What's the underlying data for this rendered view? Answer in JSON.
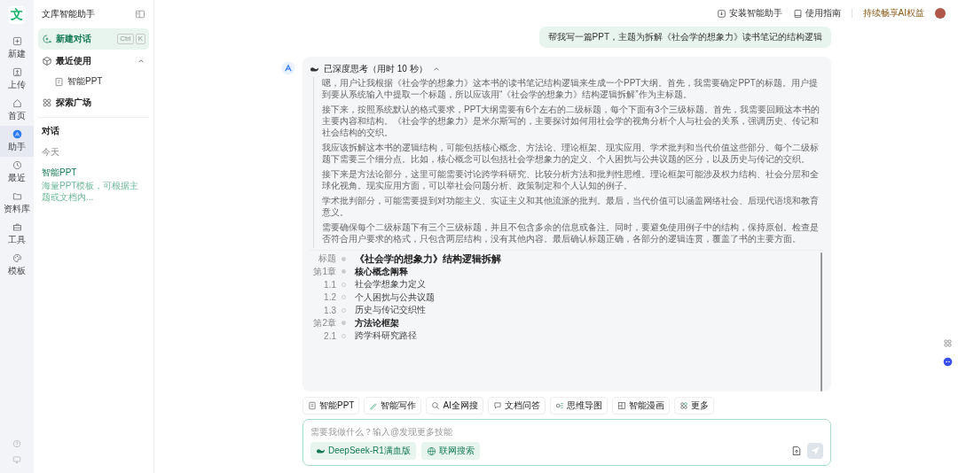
{
  "rail": {
    "logo": "文",
    "items": [
      {
        "label": "新建",
        "selected": false
      },
      {
        "label": "上传",
        "selected": false
      },
      {
        "label": "首页",
        "selected": false
      },
      {
        "label": "助手",
        "selected": true
      },
      {
        "label": "最近",
        "selected": false
      },
      {
        "label": "资料库",
        "selected": false
      },
      {
        "label": "工具",
        "selected": false
      },
      {
        "label": "模板",
        "selected": false
      }
    ]
  },
  "sidebar": {
    "title": "文库智能助手",
    "new_chat": {
      "label": "新建对话",
      "shortcut": [
        "Ctrl",
        "K"
      ]
    },
    "recent": {
      "label": "最近使用",
      "expanded": true,
      "children": [
        {
          "label": "智能PPT"
        }
      ]
    },
    "explore": {
      "label": "探索广场"
    },
    "chats_heading": "对话",
    "groups": [
      {
        "label": "今天",
        "items": [
          {
            "title": "智能PPT",
            "subtitle": "海量PPT模板，可根据主题或文档内...",
            "selected": true
          }
        ]
      }
    ]
  },
  "top_bar": {
    "links": [
      {
        "label": "安装智能助手"
      },
      {
        "label": "使用指南"
      }
    ],
    "promo": "持续畅享AI权益"
  },
  "user_message": "帮我写一篇PPT，主题为拆解《社会学的想象力》读书笔记的结构逻辑",
  "assistant": {
    "thinking": {
      "label": "已深度思考（用时 10 秒）",
      "expanded": true,
      "paragraphs": [
        "嗯，用户让我根据《社会学的想象力》这本书的读书笔记结构逻辑来生成一个PPT大纲。首先，我需要确定PPT的标题。用户提到要从系统输入中提取一个标题，所以应该用“《社会学的想象力》结构逻辑拆解”作为主标题。",
        "接下来，按照系统默认的格式要求，PPT大纲需要有6个左右的二级标题，每个下面有3个三级标题。首先，我需要回顾这本书的主要内容和结构。《社会学的想象力》是米尔斯写的，主要探讨如何用社会学的视角分析个人与社会的关系，强调历史、传记和社会结构的交织。",
        "我应该拆解这本书的逻辑结构，可能包括核心概念、方法论、理论框架、现实应用、学术批判和当代价值这些部分。每个二级标题下需要三个细分点。比如，核心概念可以包括社会学想象力的定义、个人困扰与公共议题的区分，以及历史与传记的交织。",
        "接下来是方法论部分，这里可能需要讨论跨学科研究、比较分析方法和批判性思维。理论框架可能涉及权力结构、社会分层和全球化视角。现实应用方面，可以举社会问题分析、政策制定和个人认知的例子。",
        "学术批判部分，可能需要提到对功能主义、实证主义和其他流派的批判。最后，当代价值可以涵盖网络社会、后现代语境和教育意义。",
        "需要确保每个二级标题下有三个三级标题，并且不包含多余的信息或备注。同时，要避免使用例子中的结构，保持原创。检查是否符合用户要求的格式，只包含两层结构，没有其他内容。最后确认标题正确，各部分的逻辑连贯，覆盖了书的主要方面。"
      ]
    },
    "outline": [
      {
        "kind": "title",
        "label": "标题",
        "text": "《社会学的想象力》结构逻辑拆解"
      },
      {
        "kind": "chapter",
        "label": "第1章",
        "text": "核心概念阐释"
      },
      {
        "kind": "section",
        "label": "1.1",
        "text": "社会学想象力定义"
      },
      {
        "kind": "section",
        "label": "1.2",
        "text": "个人困扰与公共议题"
      },
      {
        "kind": "section",
        "label": "1.3",
        "text": "历史与传记交织性"
      },
      {
        "kind": "chapter",
        "label": "第2章",
        "text": "方法论框架"
      },
      {
        "kind": "section",
        "label": "2.1",
        "text": "跨学科研究路径"
      }
    ]
  },
  "tools": [
    {
      "label": "智能PPT"
    },
    {
      "label": "智能写作"
    },
    {
      "label": "AI全网搜"
    },
    {
      "label": "文档问答"
    },
    {
      "label": "思维导图"
    },
    {
      "label": "智能漫画"
    },
    {
      "label": "更多"
    }
  ],
  "composer": {
    "placeholder": "需要我做什么？输入@发现更多技能",
    "options": [
      {
        "label": "DeepSeek-R1满血版"
      },
      {
        "label": "联网搜索"
      }
    ]
  }
}
